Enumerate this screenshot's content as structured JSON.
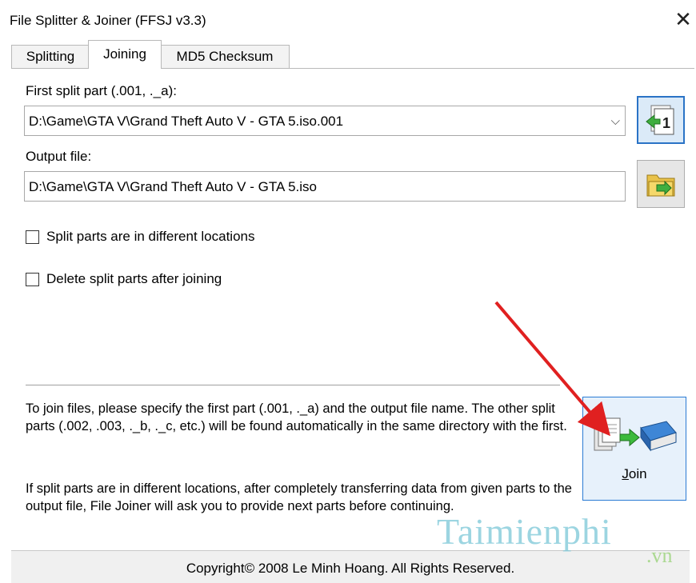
{
  "window": {
    "title": "File Splitter & Joiner (FFSJ v3.3)",
    "close": "✕"
  },
  "tabs": [
    {
      "label": "Splitting",
      "active": false
    },
    {
      "label": "Joining",
      "active": true
    },
    {
      "label": "MD5 Checksum",
      "active": false
    }
  ],
  "first_part": {
    "label": "First split part (.001, ._a):",
    "value": "D:\\Game\\GTA V\\Grand Theft Auto V - GTA 5.iso.001",
    "dropdown_icon": "chevron-down-icon"
  },
  "output": {
    "label": "Output file:",
    "value": "D:\\Game\\GTA V\\Grand Theft Auto V - GTA 5.iso"
  },
  "options": {
    "different_locations": {
      "label": "Split parts are in different locations",
      "checked": false
    },
    "delete_after": {
      "label": "Delete split parts after joining",
      "checked": false
    }
  },
  "help": {
    "paragraph1": "To join files, please specify the first part (.001, ._a) and the output file name. The other split parts (.002, .003, ._b, ._c, etc.) will be found automatically in the same directory with the first.",
    "paragraph2": "If split parts are in different locations, after completely transferring data from given parts to the output file, File Joiner will ask you to provide next parts before continuing."
  },
  "join_button": {
    "label": "Join",
    "accesskey": "J"
  },
  "status": {
    "copyright": "Copyright© 2008 Le Minh Hoang. All Rights Reserved."
  },
  "watermark": {
    "text": "Taimienphi",
    "suffix": ".vn"
  },
  "colors": {
    "accent": "#2a73c6",
    "annotation_arrow": "#e02020"
  }
}
